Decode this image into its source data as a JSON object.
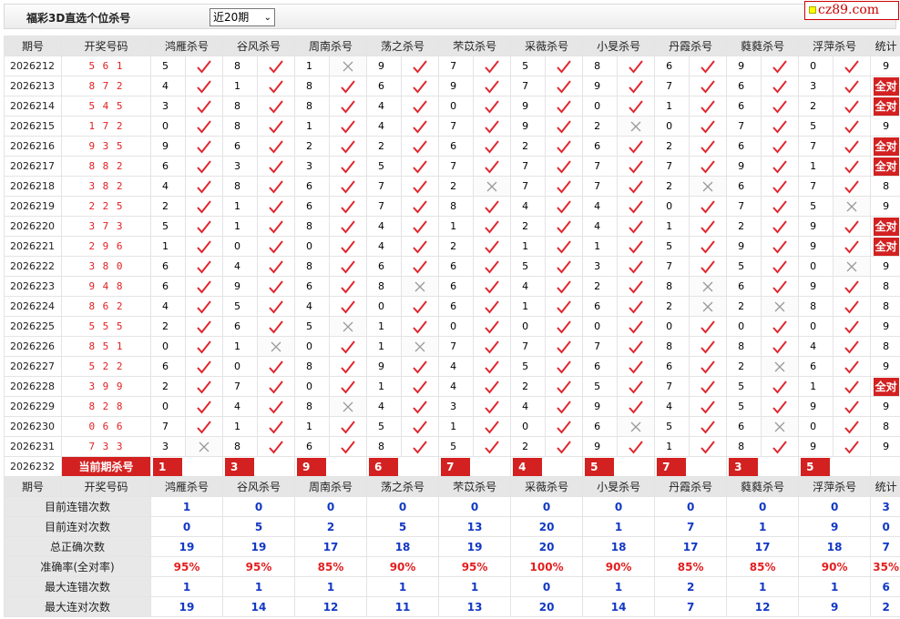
{
  "header": {
    "title": "福彩3D直选个位杀号",
    "period_selected": "近20期",
    "site_logo": "cz89.com"
  },
  "columns": {
    "period": "期号",
    "prize": "开奖号码",
    "experts": [
      "鸿雁杀号",
      "谷风杀号",
      "周南杀号",
      "荡之杀号",
      "芣苡杀号",
      "采薇杀号",
      "小旻杀号",
      "丹霞杀号",
      "蕤蕤杀号",
      "浮萍杀号"
    ],
    "total": "统计"
  },
  "rows": [
    {
      "period": "2026212",
      "prize": "5 6 1",
      "kill": [
        "5",
        "8",
        "1",
        "9",
        "7",
        "5",
        "8",
        "6",
        "9",
        "0"
      ],
      "ok": [
        1,
        1,
        0,
        1,
        1,
        1,
        1,
        1,
        1,
        1
      ],
      "total": "9"
    },
    {
      "period": "2026213",
      "prize": "8 7 2",
      "kill": [
        "4",
        "1",
        "8",
        "6",
        "9",
        "7",
        "9",
        "7",
        "6",
        "3"
      ],
      "ok": [
        1,
        1,
        1,
        1,
        1,
        1,
        1,
        1,
        1,
        1
      ],
      "total": "全对"
    },
    {
      "period": "2026214",
      "prize": "5 4 5",
      "kill": [
        "3",
        "8",
        "8",
        "4",
        "0",
        "9",
        "0",
        "1",
        "6",
        "2"
      ],
      "ok": [
        1,
        1,
        1,
        1,
        1,
        1,
        1,
        1,
        1,
        1
      ],
      "total": "全对"
    },
    {
      "period": "2026215",
      "prize": "1 7 2",
      "kill": [
        "0",
        "8",
        "1",
        "4",
        "7",
        "9",
        "2",
        "0",
        "7",
        "5"
      ],
      "ok": [
        1,
        1,
        1,
        1,
        1,
        1,
        0,
        1,
        1,
        1
      ],
      "total": "9"
    },
    {
      "period": "2026216",
      "prize": "9 3 5",
      "kill": [
        "9",
        "6",
        "2",
        "2",
        "6",
        "2",
        "6",
        "2",
        "6",
        "7"
      ],
      "ok": [
        1,
        1,
        1,
        1,
        1,
        1,
        1,
        1,
        1,
        1
      ],
      "total": "全对"
    },
    {
      "period": "2026217",
      "prize": "8 8 2",
      "kill": [
        "6",
        "3",
        "3",
        "5",
        "7",
        "7",
        "7",
        "7",
        "9",
        "1"
      ],
      "ok": [
        1,
        1,
        1,
        1,
        1,
        1,
        1,
        1,
        1,
        1
      ],
      "total": "全对"
    },
    {
      "period": "2026218",
      "prize": "3 8 2",
      "kill": [
        "4",
        "8",
        "6",
        "7",
        "2",
        "7",
        "7",
        "2",
        "6",
        "7"
      ],
      "ok": [
        1,
        1,
        1,
        1,
        0,
        1,
        1,
        0,
        1,
        1
      ],
      "total": "8"
    },
    {
      "period": "2026219",
      "prize": "2 2 5",
      "kill": [
        "2",
        "1",
        "6",
        "7",
        "8",
        "4",
        "4",
        "0",
        "7",
        "5"
      ],
      "ok": [
        1,
        1,
        1,
        1,
        1,
        1,
        1,
        1,
        1,
        0
      ],
      "total": "9"
    },
    {
      "period": "2026220",
      "prize": "3 7 3",
      "kill": [
        "5",
        "1",
        "8",
        "4",
        "1",
        "2",
        "4",
        "1",
        "2",
        "9"
      ],
      "ok": [
        1,
        1,
        1,
        1,
        1,
        1,
        1,
        1,
        1,
        1
      ],
      "total": "全对"
    },
    {
      "period": "2026221",
      "prize": "2 9 6",
      "kill": [
        "1",
        "0",
        "0",
        "4",
        "2",
        "1",
        "1",
        "5",
        "9",
        "9"
      ],
      "ok": [
        1,
        1,
        1,
        1,
        1,
        1,
        1,
        1,
        1,
        1
      ],
      "total": "全对"
    },
    {
      "period": "2026222",
      "prize": "3 8 0",
      "kill": [
        "6",
        "4",
        "8",
        "6",
        "6",
        "5",
        "3",
        "7",
        "5",
        "0"
      ],
      "ok": [
        1,
        1,
        1,
        1,
        1,
        1,
        1,
        1,
        1,
        0
      ],
      "total": "9"
    },
    {
      "period": "2026223",
      "prize": "9 4 8",
      "kill": [
        "6",
        "9",
        "6",
        "8",
        "6",
        "4",
        "2",
        "8",
        "6",
        "9"
      ],
      "ok": [
        1,
        1,
        1,
        0,
        1,
        1,
        1,
        0,
        1,
        1
      ],
      "total": "8"
    },
    {
      "period": "2026224",
      "prize": "8 6 2",
      "kill": [
        "4",
        "5",
        "4",
        "0",
        "6",
        "1",
        "6",
        "2",
        "2",
        "8"
      ],
      "ok": [
        1,
        1,
        1,
        1,
        1,
        1,
        1,
        0,
        0,
        1
      ],
      "total": "8"
    },
    {
      "period": "2026225",
      "prize": "5 5 5",
      "kill": [
        "2",
        "6",
        "5",
        "1",
        "0",
        "0",
        "0",
        "0",
        "0",
        "0"
      ],
      "ok": [
        1,
        1,
        0,
        1,
        1,
        1,
        1,
        1,
        1,
        1
      ],
      "total": "9"
    },
    {
      "period": "2026226",
      "prize": "8 5 1",
      "kill": [
        "0",
        "1",
        "0",
        "1",
        "7",
        "7",
        "7",
        "8",
        "8",
        "4"
      ],
      "ok": [
        1,
        0,
        1,
        0,
        1,
        1,
        1,
        1,
        1,
        1
      ],
      "total": "8"
    },
    {
      "period": "2026227",
      "prize": "5 2 2",
      "kill": [
        "6",
        "0",
        "8",
        "9",
        "4",
        "5",
        "6",
        "6",
        "2",
        "6"
      ],
      "ok": [
        1,
        1,
        1,
        1,
        1,
        1,
        1,
        1,
        0,
        1
      ],
      "total": "9"
    },
    {
      "period": "2026228",
      "prize": "3 9 9",
      "kill": [
        "2",
        "7",
        "0",
        "1",
        "4",
        "2",
        "5",
        "7",
        "5",
        "1"
      ],
      "ok": [
        1,
        1,
        1,
        1,
        1,
        1,
        1,
        1,
        1,
        1
      ],
      "total": "全对"
    },
    {
      "period": "2026229",
      "prize": "8 2 8",
      "kill": [
        "0",
        "4",
        "8",
        "4",
        "3",
        "4",
        "9",
        "4",
        "5",
        "9"
      ],
      "ok": [
        1,
        1,
        0,
        1,
        1,
        1,
        1,
        1,
        1,
        1
      ],
      "total": "9"
    },
    {
      "period": "2026230",
      "prize": "0 6 6",
      "kill": [
        "7",
        "1",
        "1",
        "5",
        "1",
        "0",
        "6",
        "5",
        "6",
        "0"
      ],
      "ok": [
        1,
        1,
        1,
        1,
        1,
        1,
        0,
        1,
        0,
        1
      ],
      "total": "8"
    },
    {
      "period": "2026231",
      "prize": "7 3 3",
      "kill": [
        "3",
        "8",
        "6",
        "8",
        "5",
        "2",
        "9",
        "1",
        "8",
        "9"
      ],
      "ok": [
        0,
        1,
        1,
        1,
        1,
        1,
        1,
        1,
        1,
        1
      ],
      "total": "9"
    }
  ],
  "current": {
    "period": "2026232",
    "label": "当前期杀号",
    "kills": [
      "1",
      "3",
      "9",
      "6",
      "7",
      "4",
      "5",
      "7",
      "3",
      "5"
    ]
  },
  "stats": [
    {
      "label": "目前连错次数",
      "values": [
        "1",
        "0",
        "0",
        "0",
        "0",
        "0",
        "0",
        "0",
        "0",
        "0",
        "3"
      ]
    },
    {
      "label": "目前连对次数",
      "values": [
        "0",
        "5",
        "2",
        "5",
        "13",
        "20",
        "1",
        "7",
        "1",
        "9",
        "0"
      ]
    },
    {
      "label": "总正确次数",
      "values": [
        "19",
        "19",
        "17",
        "18",
        "19",
        "20",
        "18",
        "17",
        "17",
        "18",
        "7"
      ]
    },
    {
      "label": "准确率(全对率)",
      "values": [
        "95%",
        "95%",
        "85%",
        "90%",
        "95%",
        "100%",
        "90%",
        "85%",
        "85%",
        "90%",
        "35%"
      ]
    },
    {
      "label": "最大连错次数",
      "values": [
        "1",
        "1",
        "1",
        "1",
        "1",
        "0",
        "1",
        "2",
        "1",
        "1",
        "6"
      ]
    },
    {
      "label": "最大连对次数",
      "values": [
        "19",
        "14",
        "12",
        "11",
        "13",
        "20",
        "14",
        "7",
        "12",
        "9",
        "2"
      ]
    }
  ],
  "colors": {
    "check": "#e0262e",
    "cross": "#9a9a9a",
    "accent": "#d32121",
    "stat_blue": "#1238c4"
  },
  "icons": {
    "correct": "check-icon",
    "wrong": "cross-icon"
  }
}
